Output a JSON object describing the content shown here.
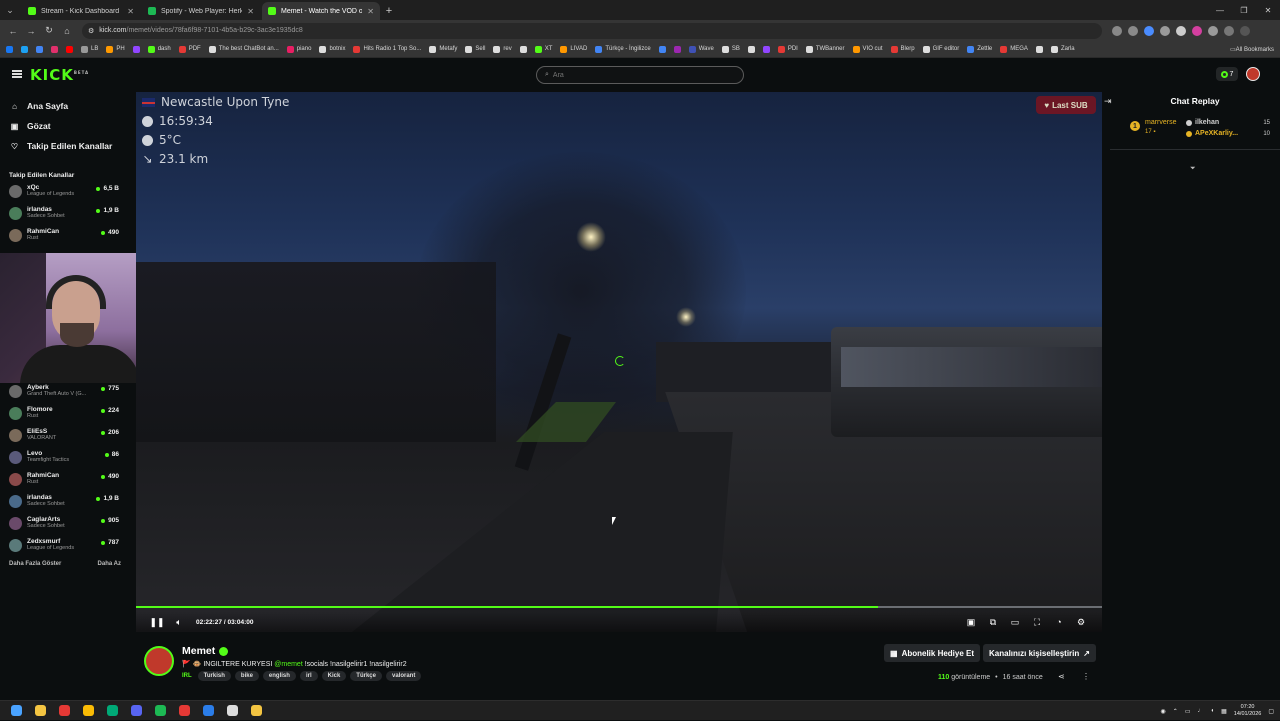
{
  "browser": {
    "tabs": [
      {
        "title": "Stream - Kick Dashboard",
        "color": "#53fc18",
        "active": false
      },
      {
        "title": "Spotify - Web Player: Herkes iç",
        "color": "#1db954",
        "active": false
      },
      {
        "title": "Memet - Watch the VOD o",
        "color": "#53fc18",
        "active": true
      }
    ],
    "url_host": "kick.com",
    "url_path": "/memet/videos/78fa6f98-7101-4b5a-b29c-3ac3e1935dc8",
    "bookmarks": [
      {
        "label": "",
        "color": "#1877f2"
      },
      {
        "label": "",
        "color": "#1da1f2"
      },
      {
        "label": "",
        "color": "#4285f4"
      },
      {
        "label": "",
        "color": "#e1306c"
      },
      {
        "label": "",
        "color": "#ff0000"
      },
      {
        "label": "LB",
        "color": "#999"
      },
      {
        "label": "PH",
        "color": "#ff9900"
      },
      {
        "label": "",
        "color": "#9146ff"
      },
      {
        "label": "dash",
        "color": "#53fc18"
      },
      {
        "label": "PDF",
        "color": "#e53935"
      },
      {
        "label": "The best ChatBot an...",
        "color": "#ddd"
      },
      {
        "label": "piano",
        "color": "#e91e63"
      },
      {
        "label": "botnix",
        "color": "#ddd"
      },
      {
        "label": "Hits Radio 1 Top So...",
        "color": "#e53935"
      },
      {
        "label": "Metafy",
        "color": "#ddd"
      },
      {
        "label": "Sell",
        "color": "#ddd"
      },
      {
        "label": "rev",
        "color": "#ddd"
      },
      {
        "label": "",
        "color": "#ddd"
      },
      {
        "label": "XT",
        "color": "#53fc18"
      },
      {
        "label": "LIVAD",
        "color": "#ff9800"
      },
      {
        "label": "Türkçe - İngilizce",
        "color": "#4285f4"
      },
      {
        "label": "",
        "color": "#4285f4"
      },
      {
        "label": "",
        "color": "#9c27b0"
      },
      {
        "label": "Wave",
        "color": "#3f51b5"
      },
      {
        "label": "SB",
        "color": "#ddd"
      },
      {
        "label": "",
        "color": "#ddd"
      },
      {
        "label": "",
        "color": "#9146ff"
      },
      {
        "label": "PDI",
        "color": "#e53935"
      },
      {
        "label": "TWBanner",
        "color": "#ddd"
      },
      {
        "label": "VIO cut",
        "color": "#ff9800"
      },
      {
        "label": "Blerp",
        "color": "#e53935"
      },
      {
        "label": "GIF editor",
        "color": "#ddd"
      },
      {
        "label": "Zettle",
        "color": "#4285f4"
      },
      {
        "label": "MEGA",
        "color": "#e53935"
      },
      {
        "label": "",
        "color": "#ddd"
      },
      {
        "label": "Zarla",
        "color": "#ddd"
      }
    ],
    "all_bookmarks": "All Bookmarks"
  },
  "kick": {
    "search_placeholder": "Ara",
    "notif_count": "7",
    "nav": [
      {
        "label": "Ana Sayfa",
        "icon": "home-icon",
        "glyph": "⌂"
      },
      {
        "label": "Gözat",
        "icon": "browse-icon",
        "glyph": "▣"
      },
      {
        "label": "Takip Edilen Kanallar",
        "icon": "heart-icon",
        "glyph": "♡"
      }
    ],
    "followed_header": "Takip Edilen Kanallar",
    "followed": [
      {
        "name": "xQc",
        "game": "League of Legends",
        "viewers": "6,5 B"
      },
      {
        "name": "irlandas",
        "game": "Sadece Sohbet",
        "viewers": "1,9 B"
      },
      {
        "name": "RahmiCan",
        "game": "Rust",
        "viewers": "490"
      }
    ],
    "recommended": [
      {
        "name": "Ayberk",
        "game": "Grand Theft Auto V (G...",
        "viewers": "775"
      },
      {
        "name": "Flomore",
        "game": "Rust",
        "viewers": "224"
      },
      {
        "name": "EliEsS",
        "game": "VALORANT",
        "viewers": "206"
      },
      {
        "name": "Levo",
        "game": "Teamfight Tactics",
        "viewers": "86"
      },
      {
        "name": "RahmiCan",
        "game": "Rust",
        "viewers": "490"
      },
      {
        "name": "irlandas",
        "game": "Sadece Sohbet",
        "viewers": "1,9 B"
      },
      {
        "name": "CaglarArts",
        "game": "Sadece Sohbet",
        "viewers": "905"
      },
      {
        "name": "Zedxsmurf",
        "game": "League of Legends",
        "viewers": "787"
      }
    ],
    "show_more": "Daha Fazla Göster",
    "show_less": "Daha Az"
  },
  "video": {
    "overlay_location": "Newcastle Upon Tyne",
    "overlay_time": "16:59:34",
    "overlay_temp": "5°C",
    "overlay_distance": "23.1 km",
    "last_sub": "Last SUB",
    "progress": 0.768,
    "time_current": "02:22:27",
    "time_total": "03:04:00"
  },
  "chat": {
    "title": "Chat Replay",
    "pin_rank": "1",
    "pin_user": "marrverse",
    "pin_count": "17",
    "top": [
      {
        "name": "ilkehan",
        "value": "15",
        "color": "#cfcfcf"
      },
      {
        "name": "APeXKarliy...",
        "value": "10",
        "color": "#e7b425"
      }
    ]
  },
  "stream": {
    "name": "Memet",
    "title_prefix": "🚩 🐵 INGILTERE KURYESI",
    "mention": "@memet",
    "title_suffix": "!socials !nasilgelirir1 !nasilgelirir2",
    "category": "IRL",
    "tags": [
      "Turkish",
      "bike",
      "english",
      "irl",
      "Kick",
      "Türkçe",
      "valorant"
    ],
    "gift_sub": "Abonelik Hediye Et",
    "customize": "Kanalınızı kişiselleştirin",
    "views_count": "110",
    "views_label": "görüntüleme",
    "ago": "16 saat önce"
  },
  "taskbar": {
    "icons": [
      {
        "name": "windows-start-icon",
        "color": "#4aa3ff"
      },
      {
        "name": "file-explorer-icon",
        "color": "#f4c542"
      },
      {
        "name": "app-red-icon",
        "color": "#e53935"
      },
      {
        "name": "chrome-icon",
        "color": "#fbbc05"
      },
      {
        "name": "app-green-ring-icon",
        "color": "#0a7"
      },
      {
        "name": "discord-icon",
        "color": "#5865f2"
      },
      {
        "name": "spotify-icon",
        "color": "#1db954"
      },
      {
        "name": "obs-icon",
        "color": "#e53935"
      },
      {
        "name": "app-blue-icon",
        "color": "#2b7de9"
      },
      {
        "name": "app-white-icon",
        "color": "#ddd"
      },
      {
        "name": "app-yellow-icon",
        "color": "#f4c542"
      }
    ],
    "time": "07:20",
    "date": "14/01/2026"
  }
}
